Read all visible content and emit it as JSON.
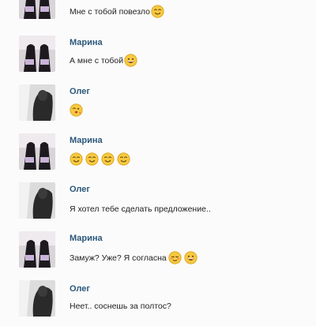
{
  "messages": [
    {
      "sender": "",
      "avatar": "marina",
      "text": "Мне с тобой повезло",
      "emojis": [
        "smile-wink"
      ]
    },
    {
      "sender": "Марина",
      "avatar": "marina",
      "text": "А мне с тобой",
      "emojis": [
        "grin"
      ]
    },
    {
      "sender": "Олег",
      "avatar": "oleg",
      "text": "",
      "emojis": [
        "kiss"
      ]
    },
    {
      "sender": "Марина",
      "avatar": "marina",
      "text": "",
      "emojis": [
        "smile-wink",
        "smile-wink",
        "smile-wink",
        "smile-wink"
      ]
    },
    {
      "sender": "Олег",
      "avatar": "oleg",
      "text": "Я хотел тебе сделать предложение..",
      "emojis": []
    },
    {
      "sender": "Марина",
      "avatar": "marina",
      "text": "Замуж? Уже? Я согласна",
      "emojis": [
        "blush",
        "grin"
      ]
    },
    {
      "sender": "Олег",
      "avatar": "oleg",
      "text": "Неет.. соснешь за полтос?",
      "emojis": []
    }
  ]
}
